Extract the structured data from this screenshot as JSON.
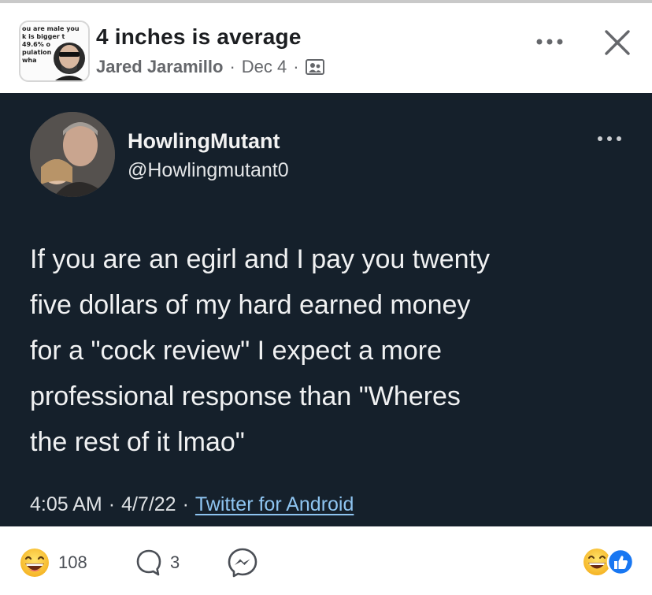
{
  "group": {
    "thumbnail_text": "ou are male you\nk is bigger t\n49.6% o\npulation\nwha"
  },
  "post": {
    "title": "4 inches is average",
    "author": "Jared Jaramillo",
    "separator": "·",
    "date": "Dec 4",
    "audience_icon": "members-icon"
  },
  "header_actions": {
    "more_icon": "more-horizontal-icon",
    "close_icon": "close-icon"
  },
  "tweet": {
    "display_name": "HowlingMutant",
    "handle": "@Howlingmutant0",
    "body_lines": [
      "If you are an egirl and I pay you twenty",
      "five dollars of my hard earned money",
      "for a \"cock review\" I expect a more",
      "professional response than \"Wheres",
      "the rest of it lmao\""
    ],
    "time": "4:05 AM",
    "sep": "·",
    "date": "4/7/22",
    "sep2": "·",
    "client": "Twitter for Android"
  },
  "reactions": {
    "count": "108",
    "comments": "3",
    "react_icon": "laughing-emoji-icon",
    "comment_icon": "comment-bubble-icon",
    "share_icon": "messenger-icon",
    "summary_icons": [
      "laughing-emoji-icon",
      "like-icon"
    ]
  },
  "colors": {
    "tweet_bg": "#15202b",
    "link": "#8ec4f0",
    "secondary_text": "#65676b"
  }
}
